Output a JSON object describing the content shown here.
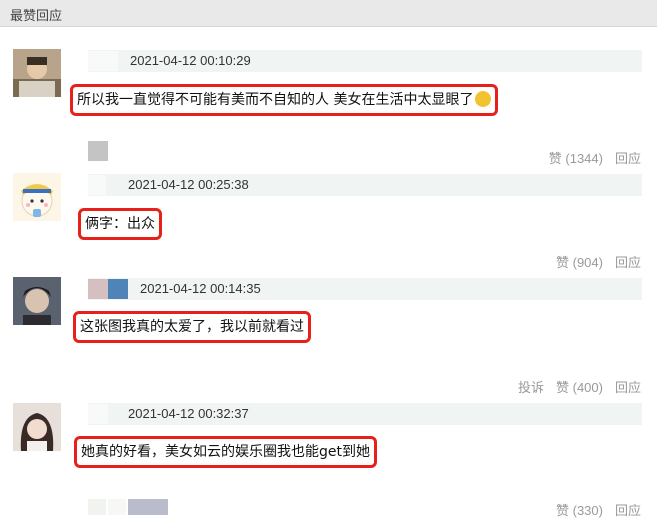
{
  "header": {
    "title": "最赞回应"
  },
  "comments": [
    {
      "timestamp": "2021-04-12 00:10:29",
      "text": "所以我一直觉得不可能有美而不自知的人 美女在生活中太显眼了",
      "like_label": "赞 (1344)",
      "reply_label": "回应"
    },
    {
      "timestamp": "2021-04-12 00:25:38",
      "text": "俩字：出众",
      "like_label": "赞 (904)",
      "reply_label": "回应"
    },
    {
      "timestamp": "2021-04-12 00:14:35",
      "text": "这张图我真的太爱了，我以前就看过",
      "report_label": "投诉",
      "like_label": "赞 (400)",
      "reply_label": "回应"
    },
    {
      "timestamp": "2021-04-12 00:32:37",
      "text": "她真的好看，美女如云的娱乐圈我也能get到她",
      "like_label": "赞 (330)",
      "reply_label": "回应"
    }
  ],
  "colors": {
    "highlight_border": "#e8201c",
    "meta_bar": "#f0f4f3",
    "header_bg": "#e9e9e9"
  }
}
